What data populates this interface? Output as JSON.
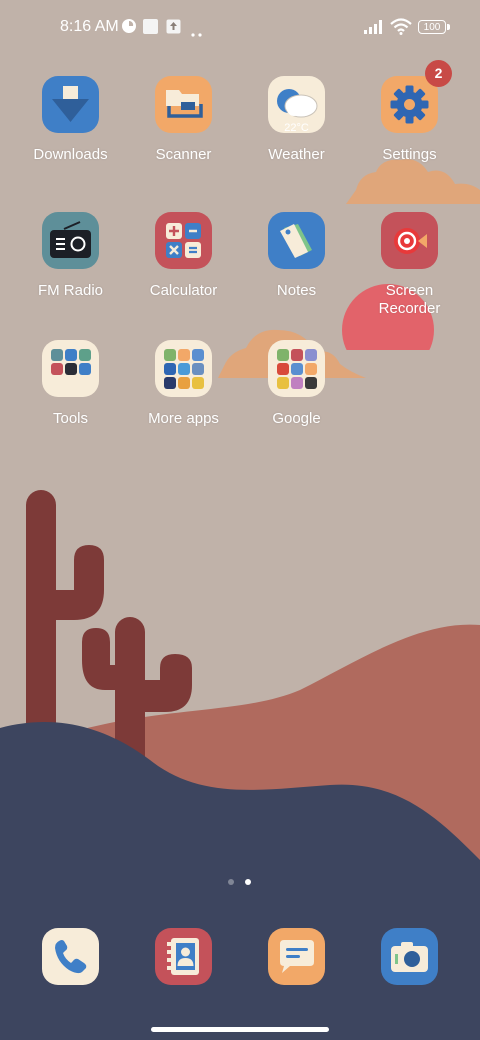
{
  "status_bar": {
    "time": "8:16 AM",
    "battery": "100",
    "icons": [
      "data-saver-icon",
      "notification-box-icon",
      "upload-icon",
      "more-dots-icon",
      "signal-icon",
      "wifi-icon",
      "battery-icon"
    ]
  },
  "home": {
    "apps": [
      {
        "label": "Downloads",
        "icon": "download-icon",
        "color": "#3f7fc7"
      },
      {
        "label": "Scanner",
        "icon": "scanner-icon",
        "color": "#f2a868"
      },
      {
        "label": "Weather",
        "icon": "weather-icon",
        "color": "#f7ecd9",
        "temp": "22°C"
      },
      {
        "label": "Settings",
        "icon": "gear-icon",
        "color": "#f2a868",
        "badge": "2"
      },
      {
        "label": "FM Radio",
        "icon": "radio-icon",
        "color": "#5e8f99"
      },
      {
        "label": "Calculator",
        "icon": "calculator-icon",
        "color": "#c4525a"
      },
      {
        "label": "Notes",
        "icon": "notes-icon",
        "color": "#3f7fc7"
      },
      {
        "label": "Screen Recorder",
        "icon": "screen-recorder-icon",
        "color": "#c4525a"
      }
    ],
    "folders": [
      {
        "label": "Tools"
      },
      {
        "label": "More apps"
      },
      {
        "label": "Google"
      }
    ]
  },
  "page_indicator": {
    "pages": 2,
    "current": 2
  },
  "dock": [
    {
      "name": "phone",
      "icon": "phone-icon",
      "color": "#f7ecd9"
    },
    {
      "name": "contacts",
      "icon": "contacts-icon",
      "color": "#c4525a"
    },
    {
      "name": "messages",
      "icon": "messages-icon",
      "color": "#f2a868"
    },
    {
      "name": "camera",
      "icon": "camera-icon",
      "color": "#3f7fc7"
    }
  ]
}
